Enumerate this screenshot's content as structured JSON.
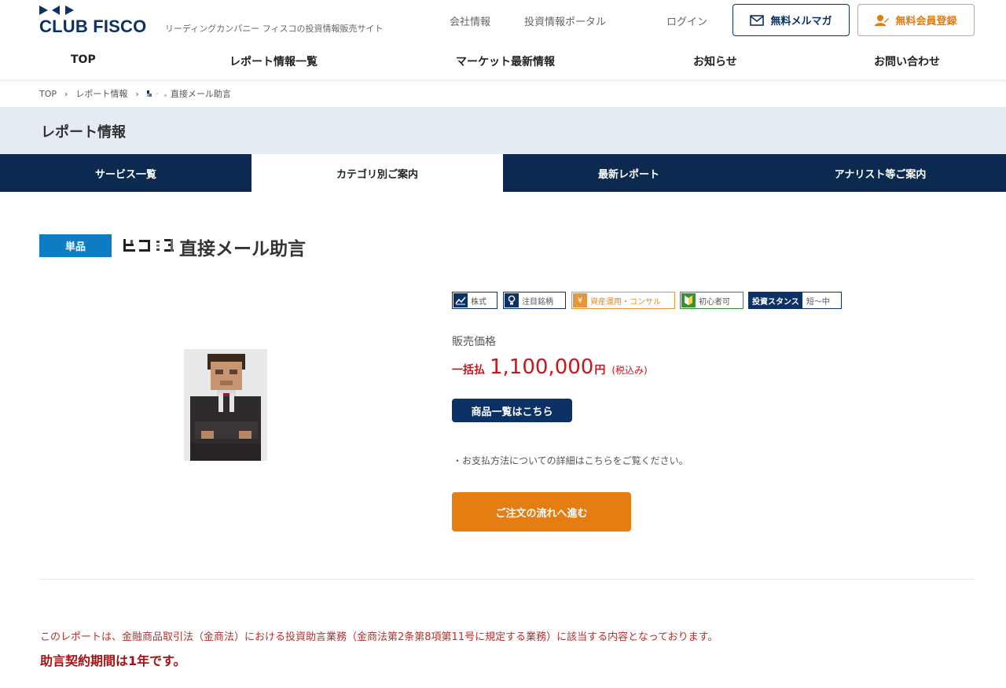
{
  "header": {
    "logo_text": "CLUB FISCO",
    "tagline": "リーディングカンパニー フィスコの投資情報販売サイト",
    "links": {
      "company": "会社情報",
      "portal": "投資情報ポータル",
      "login": "ログイン"
    },
    "mail_button": "無料メルマガ",
    "member_button": "無料会員登録",
    "brand_color": "#0c3164",
    "accent_color": "#e07c12"
  },
  "nav": [
    {
      "label": "TOP"
    },
    {
      "label": "レポート情報一覧"
    },
    {
      "label": "マーケット最新情報"
    },
    {
      "label": "お知らせ"
    },
    {
      "label": "お問い合わせ"
    }
  ],
  "breadcrumb": {
    "top": "TOP",
    "reports": "レポート情報",
    "current": "直接メール助言"
  },
  "section": {
    "title": "レポート情報"
  },
  "tabs": [
    {
      "label": "サービス一覧",
      "active": false
    },
    {
      "label": "カテゴリ別ご案内",
      "active": true
    },
    {
      "label": "最新レポート",
      "active": false
    },
    {
      "label": "アナリスト等ご案内",
      "active": false
    }
  ],
  "product": {
    "badge": "単品",
    "title": "直接メール助言",
    "tags": {
      "stock": {
        "label": "株式",
        "icon": "chart-line-icon"
      },
      "pick": {
        "label": "注目銘柄",
        "icon": "lightbulb-icon"
      },
      "asset": {
        "label": "資産運用・コンサル",
        "icon": "yen-icon"
      },
      "beginner": {
        "label": "初心者可",
        "icon": "beginner-mark-icon"
      },
      "stance": {
        "label": "投資スタンス",
        "value": "短〜中"
      }
    },
    "price_label": "販売価格",
    "price_method": "一括払",
    "price_amount": "1,100,000",
    "price_unit": "円",
    "price_tax": "(税込み)",
    "list_button": "商品一覧はこちら",
    "payment_note": "・お支払方法についての詳細はこちらをご覧ください。",
    "order_button": "ご注文の流れへ進む",
    "price_color": "#c8161d"
  },
  "notice": {
    "text": "このレポートは、金融商品取引法（金商法）における投資助言業務（金商法第2条第8項第11号に規定する業務）に該当する内容となっております。",
    "period": "助言契約期間は1年です。"
  }
}
